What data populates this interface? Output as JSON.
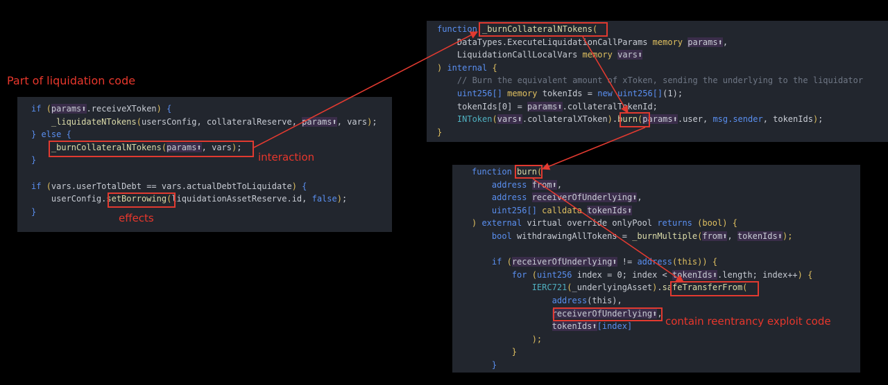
{
  "annotations": {
    "title": "Part of liquidation code",
    "interaction": "interaction",
    "effects": "effects",
    "exploit": "contain reentrancy exploit code"
  },
  "panel_liquidation": {
    "lines": [
      {
        "segs": [
          {
            "t": "if ",
            "c": "kw"
          },
          {
            "t": "(",
            "c": "ye"
          },
          {
            "t": "params",
            "c": "pa"
          },
          {
            "t": "⬆",
            "c": "pa"
          },
          {
            "t": ".receiveXToken",
            "c": ""
          },
          {
            "t": ")",
            "c": "ye"
          },
          {
            "t": " {",
            "c": "bl"
          }
        ]
      },
      {
        "segs": [
          {
            "t": "    _liquidateNTokens",
            "c": "fn"
          },
          {
            "t": "(",
            "c": "ye"
          },
          {
            "t": "usersConfig",
            "c": ""
          },
          {
            "t": ", ",
            "c": ""
          },
          {
            "t": "collateralReserve",
            "c": ""
          },
          {
            "t": ", ",
            "c": ""
          },
          {
            "t": "params⬆",
            "c": "pa"
          },
          {
            "t": ", vars",
            "c": ""
          },
          {
            "t": ")",
            "c": "ye"
          },
          {
            "t": ";",
            "c": ""
          }
        ]
      },
      {
        "segs": [
          {
            "t": "} else {",
            "c": "bl"
          }
        ]
      },
      {
        "segs": [
          {
            "t": "    _burnCollateralNTokens",
            "c": "fn"
          },
          {
            "t": "(",
            "c": "ye"
          },
          {
            "t": "params⬆",
            "c": "pa"
          },
          {
            "t": ", vars",
            "c": ""
          },
          {
            "t": ")",
            "c": "ye"
          },
          {
            "t": ";",
            "c": ""
          }
        ]
      },
      {
        "segs": [
          {
            "t": "}",
            "c": "bl"
          }
        ]
      },
      {
        "segs": [
          {
            "t": "",
            "c": ""
          }
        ]
      },
      {
        "segs": [
          {
            "t": "if ",
            "c": "kw"
          },
          {
            "t": "(",
            "c": "ye"
          },
          {
            "t": "vars.userTotalDebt == vars.actualDebtToLiquidate",
            "c": ""
          },
          {
            "t": ")",
            "c": "ye"
          },
          {
            "t": " {",
            "c": "bl"
          }
        ]
      },
      {
        "segs": [
          {
            "t": "    userConfig.",
            "c": ""
          },
          {
            "t": "setBorrowing",
            "c": "fn"
          },
          {
            "t": "(",
            "c": "ye"
          },
          {
            "t": "liquidationAssetReserve.id, ",
            "c": ""
          },
          {
            "t": "false",
            "c": "kw"
          },
          {
            "t": ")",
            "c": "ye"
          },
          {
            "t": ";",
            "c": ""
          }
        ]
      },
      {
        "segs": [
          {
            "t": "}",
            "c": "bl"
          }
        ]
      }
    ]
  },
  "panel_burn_collateral": {
    "lines": [
      {
        "segs": [
          {
            "t": "function ",
            "c": "kw"
          },
          {
            "t": "_burnCollateralNTokens",
            "c": "fn"
          },
          {
            "t": "(",
            "c": "ye"
          }
        ]
      },
      {
        "segs": [
          {
            "t": "    DataTypes.ExecuteLiquidationCallParams ",
            "c": ""
          },
          {
            "t": "memory ",
            "c": "ye"
          },
          {
            "t": "params⬆",
            "c": "pa"
          },
          {
            "t": ",",
            "c": ""
          }
        ]
      },
      {
        "segs": [
          {
            "t": "    LiquidationCallLocalVars ",
            "c": ""
          },
          {
            "t": "memory ",
            "c": "ye"
          },
          {
            "t": "vars⬆",
            "c": "pa"
          }
        ]
      },
      {
        "segs": [
          {
            "t": ")",
            "c": "ye"
          },
          {
            "t": " internal ",
            "c": "kw"
          },
          {
            "t": "{",
            "c": "ye"
          }
        ]
      },
      {
        "segs": [
          {
            "t": "    // Burn the equivalent amount of xToken, sending the underlying to the liquidator",
            "c": "cm"
          }
        ]
      },
      {
        "segs": [
          {
            "t": "    uint256[] ",
            "c": "kw"
          },
          {
            "t": "memory ",
            "c": "ye"
          },
          {
            "t": "tokenIds = ",
            "c": ""
          },
          {
            "t": "new ",
            "c": "kw"
          },
          {
            "t": "uint256[]",
            "c": "kw"
          },
          {
            "t": "(1);",
            "c": ""
          }
        ]
      },
      {
        "segs": [
          {
            "t": "    tokenIds[0] = ",
            "c": ""
          },
          {
            "t": "params⬆",
            "c": "pa"
          },
          {
            "t": ".collateralTokenId;",
            "c": ""
          }
        ]
      },
      {
        "segs": [
          {
            "t": "    INToken",
            "c": "ty"
          },
          {
            "t": "(",
            "c": "ye"
          },
          {
            "t": "vars⬆",
            "c": "pa"
          },
          {
            "t": ".collateralXToken",
            "": ""
          },
          {
            "t": ")",
            "c": "ye"
          },
          {
            "t": ".",
            "c": ""
          },
          {
            "t": "burn",
            "c": "fn"
          },
          {
            "t": "(",
            "c": "ye"
          },
          {
            "t": "params⬆",
            "c": "pa"
          },
          {
            "t": ".user, ",
            "c": ""
          },
          {
            "t": "msg.sender",
            "c": "kw"
          },
          {
            "t": ", tokenIds",
            "c": ""
          },
          {
            "t": ")",
            "c": "ye"
          },
          {
            "t": ";",
            "c": ""
          }
        ]
      },
      {
        "segs": [
          {
            "t": "}",
            "c": "ye"
          }
        ]
      }
    ]
  },
  "panel_burn": {
    "lines": [
      {
        "segs": [
          {
            "t": "function ",
            "c": "kw"
          },
          {
            "t": "burn",
            "c": "fn"
          },
          {
            "t": "(",
            "c": "ye"
          }
        ]
      },
      {
        "segs": [
          {
            "t": "    address ",
            "c": "kw"
          },
          {
            "t": "from⬆",
            "c": "pa"
          },
          {
            "t": ",",
            "c": ""
          }
        ]
      },
      {
        "segs": [
          {
            "t": "    address ",
            "c": "kw"
          },
          {
            "t": "receiverOfUnderlying⬆",
            "c": "pa"
          },
          {
            "t": ",",
            "c": ""
          }
        ]
      },
      {
        "segs": [
          {
            "t": "    uint256[] ",
            "c": "kw"
          },
          {
            "t": "calldata ",
            "c": "ye"
          },
          {
            "t": "tokenIds⬆",
            "c": "pa"
          }
        ]
      },
      {
        "segs": [
          {
            "t": ") ",
            "c": "ye"
          },
          {
            "t": "external ",
            "c": "kw"
          },
          {
            "t": "virtual override onlyPool ",
            "c": ""
          },
          {
            "t": "returns ",
            "c": "kw"
          },
          {
            "t": "(bool) {",
            "c": "ye"
          }
        ]
      },
      {
        "segs": [
          {
            "t": "    bool ",
            "c": "kw"
          },
          {
            "t": "withdrawingAllTokens = ",
            "c": ""
          },
          {
            "t": "_burnMultiple",
            "c": "fn"
          },
          {
            "t": "(",
            "c": "ye"
          },
          {
            "t": "from⬆",
            "c": "pa"
          },
          {
            "t": ", ",
            "c": ""
          },
          {
            "t": "tokenIds⬆",
            "c": "pa"
          },
          {
            "t": ");",
            "c": "ye"
          }
        ]
      },
      {
        "segs": [
          {
            "t": "",
            "c": ""
          }
        ]
      },
      {
        "segs": [
          {
            "t": "    if ",
            "c": "kw"
          },
          {
            "t": "(",
            "c": "ye"
          },
          {
            "t": "receiverOfUnderlying⬆",
            "c": "pa"
          },
          {
            "t": " != ",
            "c": ""
          },
          {
            "t": "address",
            "c": "kw"
          },
          {
            "t": "(this)) {",
            "c": "ye"
          }
        ]
      },
      {
        "segs": [
          {
            "t": "        for ",
            "c": "kw"
          },
          {
            "t": "(",
            "c": "ye"
          },
          {
            "t": "uint256 ",
            "c": "kw"
          },
          {
            "t": "index = 0; index < ",
            "c": ""
          },
          {
            "t": "tokenIds⬆",
            "c": "pa"
          },
          {
            "t": ".length; index++",
            "c": ""
          },
          {
            "t": ") {",
            "c": "ye"
          }
        ]
      },
      {
        "segs": [
          {
            "t": "            IERC721",
            "c": "ty"
          },
          {
            "t": "(",
            "c": "ye"
          },
          {
            "t": "_underlyingAsset",
            "c": ""
          },
          {
            "t": ")",
            "c": "ye"
          },
          {
            "t": ".",
            "c": ""
          },
          {
            "t": "safeTransferFrom",
            "c": "fn"
          },
          {
            "t": "(",
            "c": "ye"
          }
        ]
      },
      {
        "segs": [
          {
            "t": "                address",
            "c": "kw"
          },
          {
            "t": "(this),",
            "c": ""
          }
        ]
      },
      {
        "segs": [
          {
            "t": "                ",
            "c": ""
          },
          {
            "t": "receiverOfUnderlying⬆",
            "c": "pa"
          },
          {
            "t": ",",
            "c": ""
          }
        ]
      },
      {
        "segs": [
          {
            "t": "                ",
            "c": ""
          },
          {
            "t": "tokenIds⬆",
            "c": "pa"
          },
          {
            "t": "[index]",
            "c": "kw"
          }
        ]
      },
      {
        "segs": [
          {
            "t": "            );",
            "c": "ye"
          }
        ]
      },
      {
        "segs": [
          {
            "t": "        }",
            "c": "ye"
          }
        ]
      },
      {
        "segs": [
          {
            "t": "    }",
            "c": "bl"
          }
        ]
      }
    ]
  },
  "colors": {
    "annotation": "#e8372c",
    "panel": "#22262e",
    "background": "#000000"
  }
}
